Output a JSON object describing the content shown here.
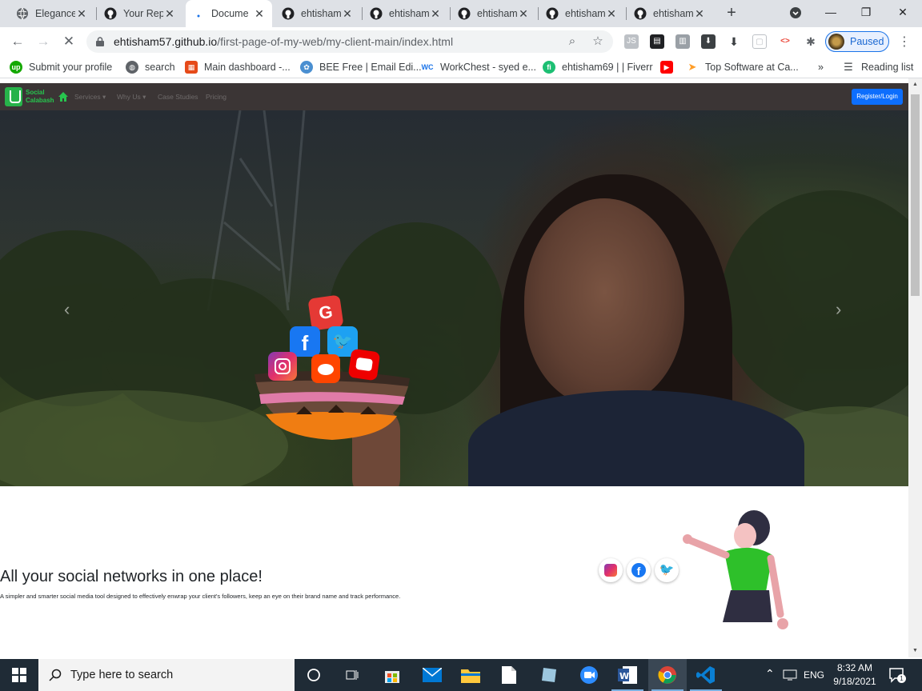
{
  "browser": {
    "tabs": [
      {
        "title": "Elegance",
        "icon": "globe-icon"
      },
      {
        "title": "Your Rep",
        "icon": "github-icon"
      },
      {
        "title": "Docume",
        "icon": "loading-icon",
        "active": true
      },
      {
        "title": "ehtisham",
        "icon": "github-icon"
      },
      {
        "title": "ehtisham",
        "icon": "github-icon"
      },
      {
        "title": "ehtisham",
        "icon": "github-icon"
      },
      {
        "title": "ehtisham",
        "icon": "github-icon"
      },
      {
        "title": "ehtisham",
        "icon": "github-icon"
      }
    ],
    "url_host": "ehtisham57.github.io",
    "url_path": "/first-page-of-my-web/my-client-main/index.html",
    "profile_label": "Paused",
    "bookmarks": [
      {
        "label": "Submit your profile",
        "icon": "upwork-icon",
        "color": "#14a800"
      },
      {
        "label": "search",
        "icon": "globe-icon",
        "color": "#5f6368"
      },
      {
        "label": "Main dashboard -...",
        "icon": "dashboard-icon",
        "color": "#e64a19"
      },
      {
        "label": "BEE Free | Email Edi...",
        "icon": "bee-icon",
        "color": "#4a8fd1"
      },
      {
        "label": "WorkChest - syed e...",
        "icon": "workchest-icon",
        "color": "#1a73e8"
      },
      {
        "label": "ehtisham69 | | Fiverr",
        "icon": "fiverr-icon",
        "color": "#1dbf73"
      },
      {
        "label": "",
        "icon": "youtube-icon",
        "color": "#ff0000"
      },
      {
        "label": "Top Software at Ca...",
        "icon": "capterra-icon",
        "color": "#ff9d28"
      }
    ],
    "reading_list": "Reading list",
    "overflow": "»"
  },
  "site": {
    "logo_line1": "Social",
    "logo_line2": "Calabash",
    "nav": [
      {
        "label": "Services ▾"
      },
      {
        "label": "Why Us ▾"
      },
      {
        "label": "Case Studies"
      },
      {
        "label": "Pricing"
      }
    ],
    "register_label": "Register/Login",
    "hero_prev": "‹",
    "hero_next": "›",
    "features_title": "All your social networks in one place!",
    "features_subtitle": "A simpler and smarter social media tool designed to effectively enwrap your client's followers, keep an eye on their brand name and track performance."
  },
  "taskbar": {
    "search_placeholder": "Type here to search",
    "language": "ENG",
    "time": "8:32 AM",
    "date": "9/18/2021",
    "notifications": "1"
  },
  "colors": {
    "accent_blue": "#0d6efd",
    "site_green": "#27b34a",
    "site_nav_bg": "#3b3535",
    "taskbar_bg": "#1f2b36"
  }
}
